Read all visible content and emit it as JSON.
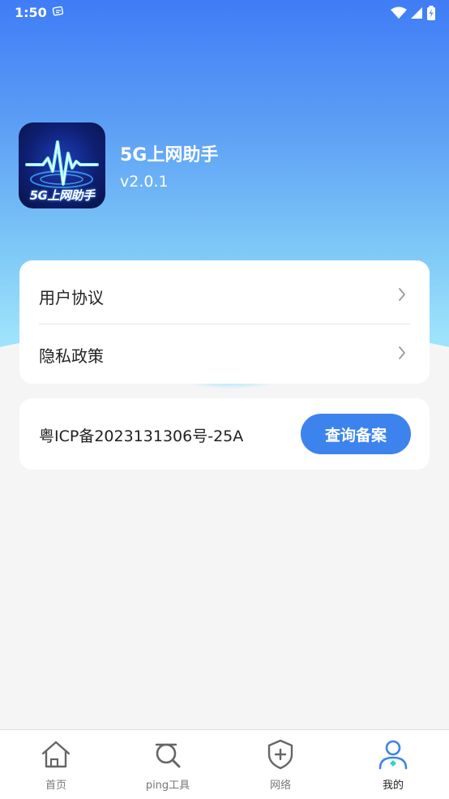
{
  "status_bar": {
    "time": "1:50"
  },
  "app": {
    "logo_text": "5G上网助手",
    "name": "5G上网助手",
    "version": "v2.0.1"
  },
  "menu": {
    "items": [
      {
        "label": "用户协议"
      },
      {
        "label": "隐私政策"
      }
    ]
  },
  "icp": {
    "text": "粤ICP备2023131306号-25A",
    "button_label": "查询备案"
  },
  "tabs": [
    {
      "label": "首页",
      "icon": "home-icon"
    },
    {
      "label": "ping工具",
      "icon": "magnifier-icon"
    },
    {
      "label": "网络",
      "icon": "shield-plus-icon"
    },
    {
      "label": "我的",
      "icon": "user-icon",
      "active": true
    }
  ],
  "colors": {
    "accent": "#3d83ee",
    "hero_top": "#3f7cf6",
    "hero_bottom": "#9ee3fb"
  }
}
